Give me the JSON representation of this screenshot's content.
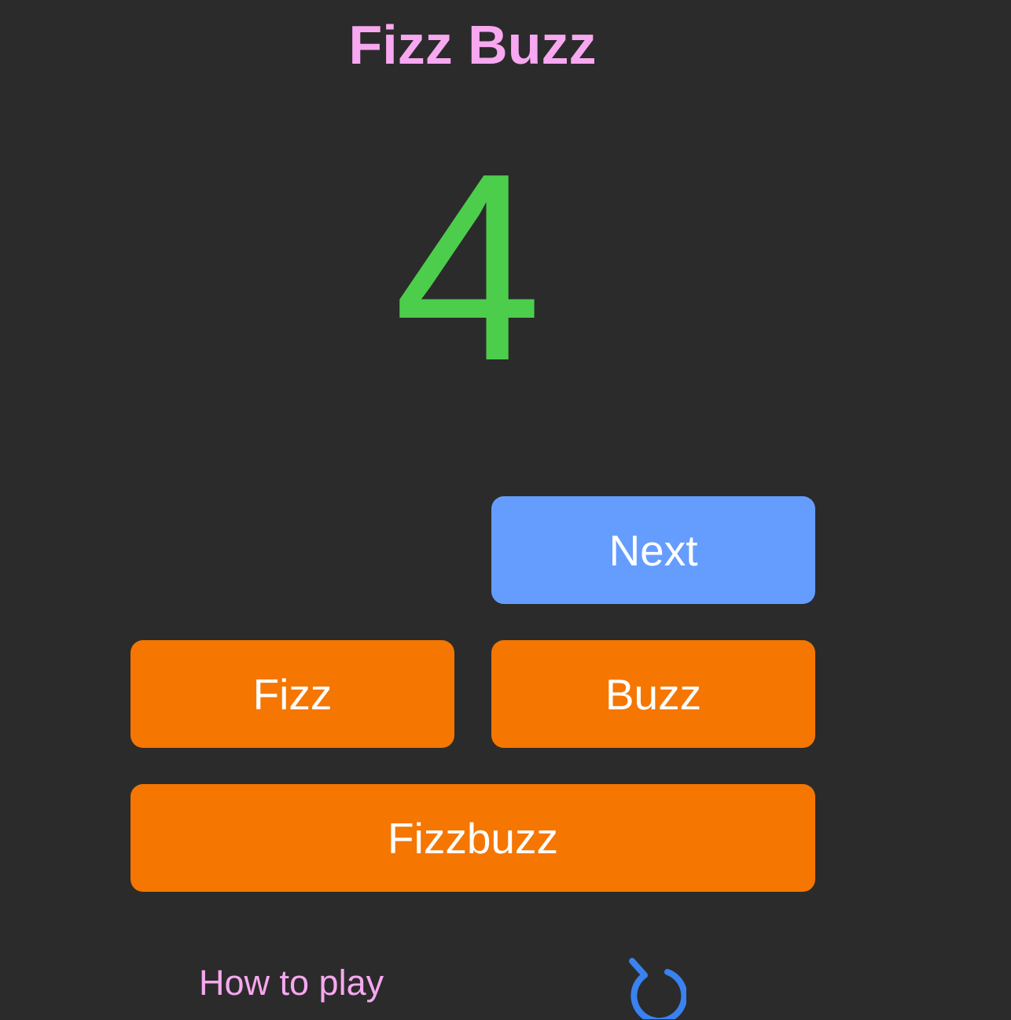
{
  "header": {
    "title": "Fizz Buzz"
  },
  "game": {
    "current_number": "4",
    "number_color": "#4ccd4c"
  },
  "controls": {
    "next_label": "Next",
    "fizz_label": "Fizz",
    "buzz_label": "Buzz",
    "fizzbuzz_label": "Fizzbuzz"
  },
  "footer": {
    "how_to_play_label": "How to play",
    "restart_icon": "restart-icon"
  },
  "colors": {
    "background": "#2b2b2b",
    "title": "#f7a8f0",
    "next_button": "#659dff",
    "answer_buttons": "#f57600",
    "restart_icon": "#3a82f0"
  }
}
